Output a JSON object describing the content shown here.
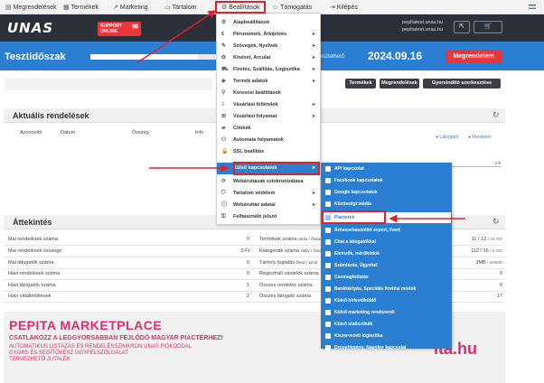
{
  "nav": {
    "items": [
      {
        "label": "Megrendelések",
        "icon": "cart-icon"
      },
      {
        "label": "Termékek",
        "icon": "box-icon"
      },
      {
        "label": "Marketing",
        "icon": "chart-icon"
      },
      {
        "label": "Tartalom",
        "icon": "document-icon"
      },
      {
        "label": "Beállítások",
        "icon": "gear-icon"
      },
      {
        "label": "Támogatás",
        "icon": "support-icon"
      },
      {
        "label": "Kilépés",
        "icon": "logout-icon"
      }
    ]
  },
  "header": {
    "logo": "UNAS",
    "support_line1": "SUPPORT",
    "support_line2": "ONLINE",
    "shop_domain1": "pepitatest.unas.hu",
    "shop_domain2": "pepitatest.unas.hu"
  },
  "trial": {
    "title": "Tesztidőszak",
    "label": "Idő tesztelhető",
    "date": "2024.09.16",
    "order_button": "Megrendelem",
    "progress_fraction": 0.85
  },
  "toolbar": {
    "products": "Termékek",
    "orders": "Megrendelések",
    "quick_edit": "Gyorsindító szerkesztése"
  },
  "orders_panel": {
    "title": "Aktuális rendelések",
    "columns": [
      "Azonosító",
      "Dátum",
      "Összeg",
      "Info"
    ],
    "legend": [
      "Látogatói",
      "Rendelés"
    ],
    "tick": "2/9"
  },
  "overview": {
    "title": "Áttekintés",
    "left": [
      {
        "label": "Mai rendelések száma",
        "value": "0"
      },
      {
        "label": "Mai rendelések összege",
        "value": "0 Ft"
      },
      {
        "label": "Mai látogatók száma",
        "value": "0"
      },
      {
        "label": "Havi rendelések száma",
        "value": "0"
      },
      {
        "label": "Havi látogatók száma",
        "value": "1"
      },
      {
        "label": "Havi oldalletöltések",
        "value": "2"
      }
    ],
    "right": [
      {
        "label": "Termékek száma",
        "note": "Aktív / Összes",
        "value": "11 / 12",
        "limit": "/ 20 000"
      },
      {
        "label": "Kategóriák száma",
        "note": "Aktív / Összes",
        "value": "112 / 16",
        "limit": "/ 5 000"
      },
      {
        "label": "Tárhely foglalás",
        "note": "Össz / Limit",
        "value": "3MB",
        "limit": "/ 500MB"
      },
      {
        "label": "Regisztrált vásárlók száma",
        "note": "",
        "value": "0",
        "limit": ""
      },
      {
        "label": "Összes rendelés száma",
        "note": "",
        "value": "0",
        "limit": ""
      },
      {
        "label": "Összes látogató száma",
        "note": "",
        "value": "17",
        "limit": ""
      }
    ]
  },
  "banner": {
    "title": "PEPITA MARKETPLACE",
    "subtitle": "CSATLAKOZZ A LEGGYORSABBAN FEJLŐDŐ MAGYAR PIACTÉRHEZ!",
    "line1": "AUTOMATIKUS LISTÁZÁS ÉS RENDELÉSSZINKRON UNAS FIÓKODDAL",
    "line2": "GYORS ÉS SEGÍTŐKÉSZ ÜGYFÉLSZOLGÁLAT",
    "line3": "TERVEZHETŐ JUTALÉK",
    "logo": "ita.hu"
  },
  "settings_menu": {
    "items": [
      {
        "label": "Alapbeállítások",
        "icon": "gear-icon",
        "submenu": false
      },
      {
        "label": "Pénznemek, Árkijelzés",
        "icon": "currency-icon",
        "submenu": true
      },
      {
        "label": "Szövegek, Nyelvek",
        "icon": "language-icon",
        "submenu": true
      },
      {
        "label": "Kinézet, Arculat",
        "icon": "palette-icon",
        "submenu": true
      },
      {
        "label": "Fizetés, Szállítás, Logisztika",
        "icon": "truck-icon",
        "submenu": true
      },
      {
        "label": "Termék adatok",
        "icon": "tag-icon",
        "submenu": true
      },
      {
        "label": "Keresési beállítások",
        "icon": "search-icon",
        "submenu": false
      },
      {
        "label": "Vásárlási feltételek",
        "icon": "doc-icon",
        "submenu": true
      },
      {
        "label": "Vásárlási folyamat",
        "icon": "cart-icon",
        "submenu": true
      },
      {
        "label": "Címkék",
        "icon": "label-icon",
        "submenu": false
      },
      {
        "label": "Automata folyamatok",
        "icon": "robot-icon",
        "submenu": false
      },
      {
        "label": "SSL beállítás",
        "icon": "lock-icon",
        "submenu": false
      },
      {
        "label": "Külső kapcsolatok",
        "icon": "link-icon",
        "submenu": true
      },
      {
        "label": "Webáruházak szinkronizálása",
        "icon": "sync-icon",
        "submenu": false
      },
      {
        "label": "Tartalom védelem",
        "icon": "shield-icon",
        "submenu": true
      },
      {
        "label": "Webáruház adatai",
        "icon": "info-icon",
        "submenu": true
      },
      {
        "label": "Felhasználó jelszó",
        "icon": "key-icon",
        "submenu": false
      }
    ]
  },
  "external_submenu": {
    "items": [
      "API kapcsolat",
      "Facebook kapcsolatok",
      "Google kapcsolatok",
      "Közösségi média",
      "Piacterek",
      "Árösszehasonlító export, Feed",
      "Chat a látogatókkal",
      "Elemzők, mérőkódok",
      "Számlázás, Ügyvitel",
      "Csomagfuttatás",
      "Bankkártyás, Speciális fizetési módok",
      "Külső hírlevélküldő",
      "Külső marketing rendszerek",
      "Külső statisztikák",
      "Kiszervezett logisztika",
      "Dropshipping, Nagyker kapcsolat"
    ]
  },
  "colors": {
    "accent": "#2a7fd3",
    "highlight_box": "#d9252a",
    "brand_pink": "#d9306d",
    "dark_header": "#2c3038"
  }
}
